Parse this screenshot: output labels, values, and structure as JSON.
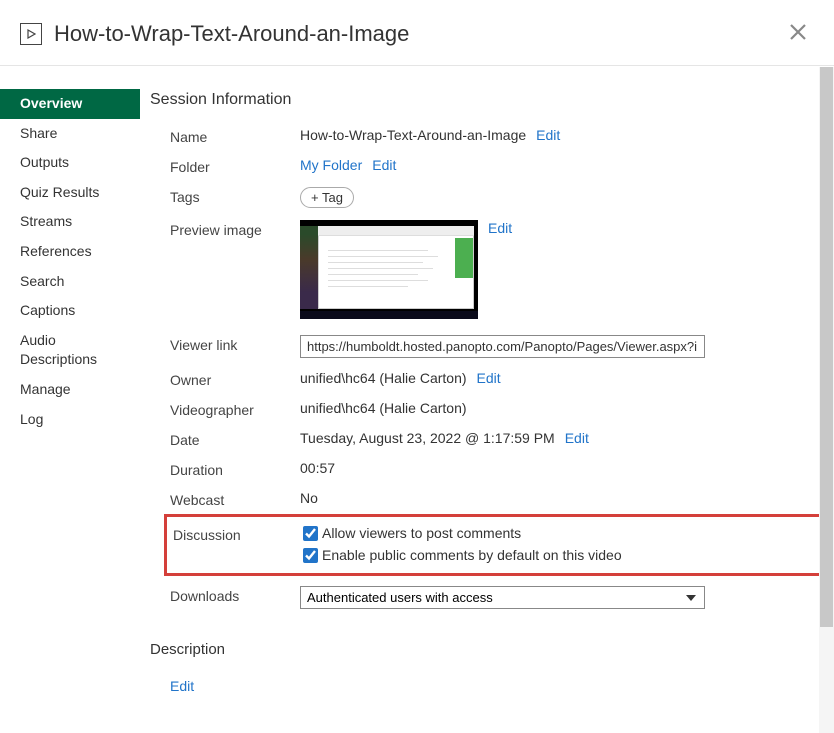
{
  "header": {
    "title": "How-to-Wrap-Text-Around-an-Image"
  },
  "sidebar": {
    "items": [
      {
        "label": "Overview",
        "active": true
      },
      {
        "label": "Share"
      },
      {
        "label": "Outputs"
      },
      {
        "label": "Quiz Results"
      },
      {
        "label": "Streams"
      },
      {
        "label": "References"
      },
      {
        "label": "Search"
      },
      {
        "label": "Captions"
      },
      {
        "label": "Audio Descriptions"
      },
      {
        "label": "Manage"
      },
      {
        "label": "Log"
      }
    ]
  },
  "section_title": "Session Information",
  "fields": {
    "name": {
      "label": "Name",
      "value": "How-to-Wrap-Text-Around-an-Image",
      "edit": "Edit"
    },
    "folder": {
      "label": "Folder",
      "value": "My Folder",
      "edit": "Edit"
    },
    "tags": {
      "label": "Tags",
      "button": "+ Tag"
    },
    "preview": {
      "label": "Preview image",
      "edit": "Edit"
    },
    "viewer_link": {
      "label": "Viewer link",
      "value": "https://humboldt.hosted.panopto.com/Panopto/Pages/Viewer.aspx?i"
    },
    "owner": {
      "label": "Owner",
      "value": "unified\\hc64 (Halie Carton)",
      "edit": "Edit"
    },
    "videographer": {
      "label": "Videographer",
      "value": "unified\\hc64 (Halie Carton)"
    },
    "date": {
      "label": "Date",
      "value": "Tuesday, August 23, 2022 @ 1:17:59 PM",
      "edit": "Edit"
    },
    "duration": {
      "label": "Duration",
      "value": "00:57"
    },
    "webcast": {
      "label": "Webcast",
      "value": "No"
    },
    "discussion": {
      "label": "Discussion",
      "option1": "Allow viewers to post comments",
      "option2": "Enable public comments by default on this video"
    },
    "downloads": {
      "label": "Downloads",
      "value": "Authenticated users with access"
    }
  },
  "description": {
    "title": "Description",
    "edit": "Edit"
  }
}
